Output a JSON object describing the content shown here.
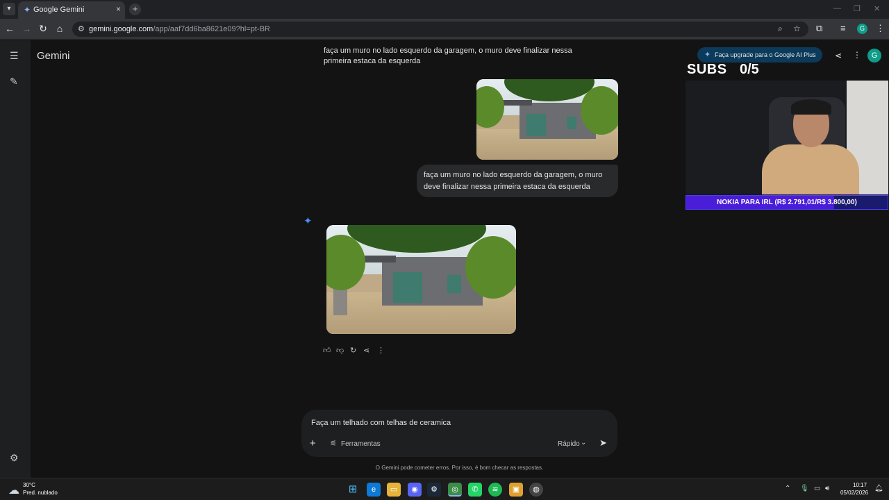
{
  "browser": {
    "tab_title": "Google Gemini",
    "url_host": "gemini.google.com",
    "url_path": "/app/aaf7dd6ba8621e09?hl=pt-BR"
  },
  "app": {
    "title": "Gemini",
    "upgrade_label": "Faça upgrade para o Google AI Plus",
    "avatar_letter": "G"
  },
  "conversation": {
    "top_prompt": "faça um muro no lado esquerdo da garagem, o muro deve finalizar nessa primeira estaca da esquerda",
    "user_message": "faça um muro no lado esquerdo da garagem, o muro deve finalizar nessa primeira estaca da esquerda"
  },
  "composer": {
    "input_value": "Faça um telhado com telhas de ceramica",
    "tools_label": "Ferramentas",
    "mode_label": "Rápido"
  },
  "disclaimer": "O Gemini pode cometer erros. Por isso, é bom checar as respostas.",
  "overlay": {
    "subs_label": "SUBS",
    "subs_count": "0/5",
    "goal_text": "NOKIA PARA IRL (R$ 2.791,01/R$ 3.800,00)",
    "goal_progress": 0.734
  },
  "taskbar": {
    "weather_temp": "30°C",
    "weather_desc": "Pred. nublado",
    "time": "10:17",
    "date": "05/02/2026"
  }
}
